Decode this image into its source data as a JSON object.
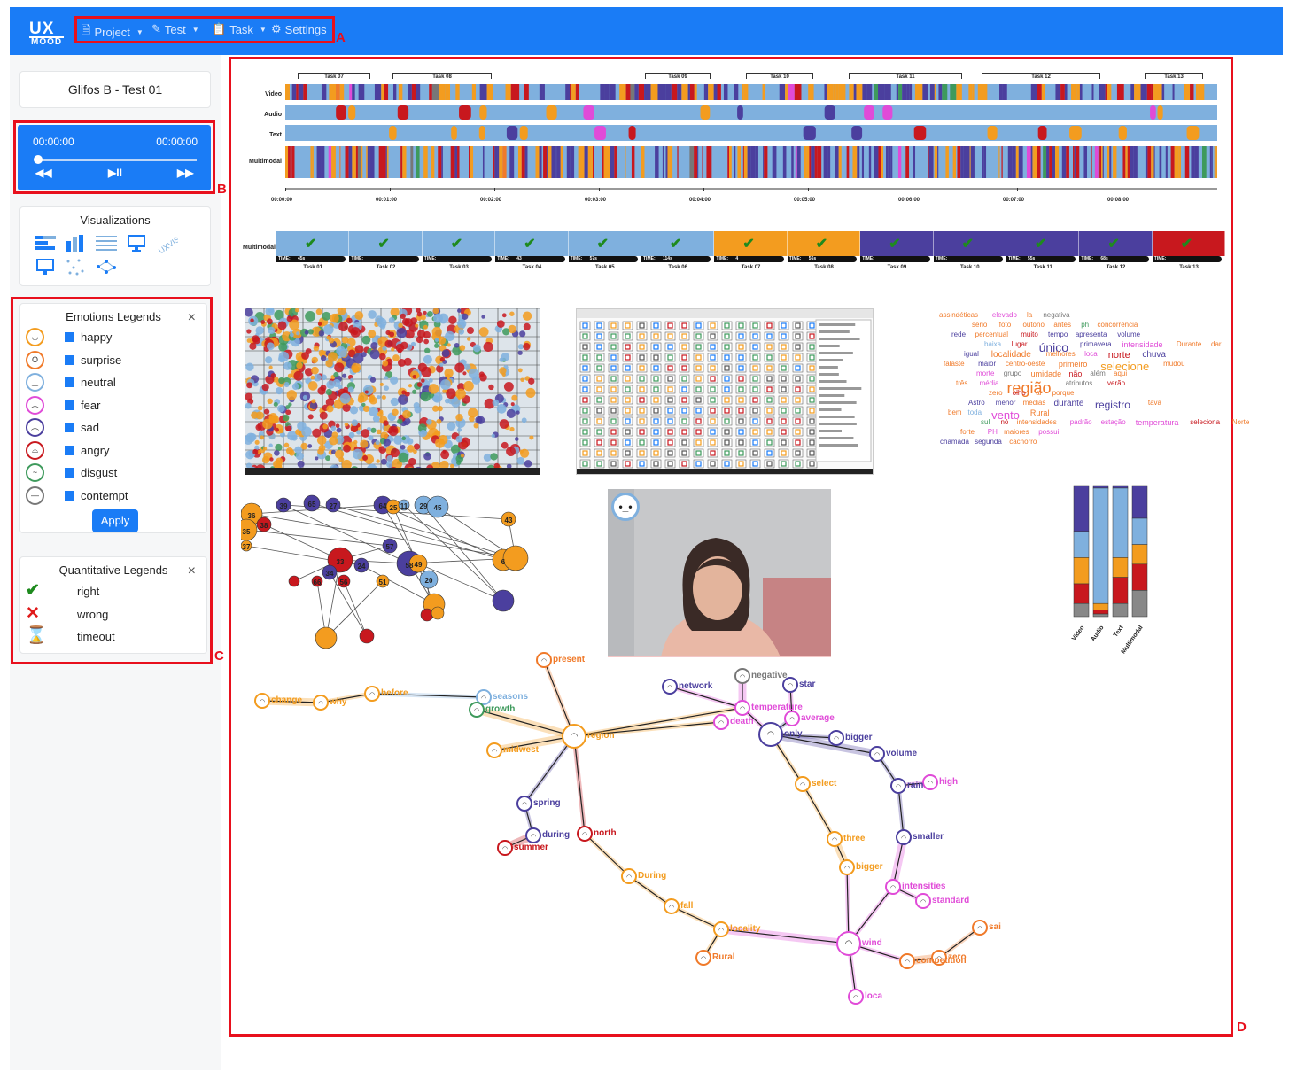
{
  "app": {
    "logo_top": "UX",
    "logo_bottom": "MOOD"
  },
  "nav": [
    {
      "label": "Project",
      "icon": "file-icon"
    },
    {
      "label": "Test",
      "icon": "test-icon"
    },
    {
      "label": "Task",
      "icon": "clipboard-icon"
    },
    {
      "label": "Settings",
      "icon": "gear-icon"
    }
  ],
  "callouts": {
    "a": "A",
    "b": "B",
    "c": "C",
    "d": "D"
  },
  "test_title": "Glifos B - Test 01",
  "player": {
    "current": "00:00:00",
    "total": "00:00:00",
    "rewind": "◀◀",
    "play_pause": "▶II",
    "forward": "▶▶",
    "progress": 0
  },
  "visualizations": {
    "title": "Visualizations",
    "icons": [
      "timeline-icon",
      "bar-chart-icon",
      "table-icon",
      "monitor-icon",
      "word-cloud-icon",
      "screen-icon",
      "scatter-icon",
      "graph-icon"
    ]
  },
  "emotions_legend": {
    "title": "Emotions Legends",
    "close": "×",
    "items": [
      {
        "label": "happy",
        "color": "#f39c1f"
      },
      {
        "label": "surprise",
        "color": "#f07a2a"
      },
      {
        "label": "neutral",
        "color": "#7fb0de"
      },
      {
        "label": "fear",
        "color": "#e04bd8"
      },
      {
        "label": "sad",
        "color": "#4b3f9e"
      },
      {
        "label": "angry",
        "color": "#c8181e"
      },
      {
        "label": "disgust",
        "color": "#3e9a5c"
      },
      {
        "label": "contempt",
        "color": "#777777"
      }
    ],
    "apply": "Apply"
  },
  "quant_legend": {
    "title": "Quantitative Legends",
    "close": "×",
    "items": [
      {
        "label": "right",
        "icon": "checkmark-icon",
        "glyph": "✔",
        "color": "#1e8a1e"
      },
      {
        "label": "wrong",
        "icon": "cross-icon",
        "glyph": "✕",
        "color": "#e01a1a"
      },
      {
        "label": "timeout",
        "icon": "hourglass-icon",
        "glyph": "⌛",
        "color": "#f08a20"
      }
    ]
  },
  "timeline": {
    "tasks": [
      "Task 07",
      "Task 08",
      "Task 09",
      "Task 10",
      "Task 11",
      "Task 12",
      "Task 13"
    ],
    "rows": [
      "Video",
      "Audio",
      "Text",
      "Multimodal"
    ],
    "time_ticks": [
      "00:00:00",
      "00:01:00",
      "00:02:00",
      "00:03:00",
      "00:04:00",
      "00:05:00",
      "00:06:00",
      "00:07:00",
      "00:08:00"
    ]
  },
  "task_bar": {
    "row_label": "Multimodal",
    "check": "✔",
    "time_prefix": "TIME:",
    "tasks": [
      {
        "label": "Task 01",
        "time": "45s",
        "color": "#7fb0de"
      },
      {
        "label": "Task 02",
        "time": "",
        "color": "#7fb0de"
      },
      {
        "label": "Task 03",
        "time": "",
        "color": "#7fb0de"
      },
      {
        "label": "Task 04",
        "time": "43",
        "color": "#7fb0de"
      },
      {
        "label": "Task 05",
        "time": "57s",
        "color": "#7fb0de"
      },
      {
        "label": "Task 06",
        "time": "114s",
        "color": "#7fb0de"
      },
      {
        "label": "Task 07",
        "time": "4",
        "color": "#f39c1f"
      },
      {
        "label": "Task 08",
        "time": "56s",
        "color": "#f39c1f"
      },
      {
        "label": "Task 09",
        "time": "",
        "color": "#4b3f9e"
      },
      {
        "label": "Task 10",
        "time": "",
        "color": "#4b3f9e"
      },
      {
        "label": "Task 11",
        "time": "55s",
        "color": "#4b3f9e"
      },
      {
        "label": "Task 12",
        "time": "68s",
        "color": "#4b3f9e"
      },
      {
        "label": "Task 13",
        "time": "",
        "color": "#c8181e"
      }
    ]
  },
  "word_cloud": [
    {
      "t": "assindéticas",
      "c": "#f07a2a",
      "s": 8
    },
    {
      "t": "elevado",
      "c": "#e04bd8",
      "s": 8
    },
    {
      "t": "la",
      "c": "#f07a2a",
      "s": 8
    },
    {
      "t": "negativa",
      "c": "#777777",
      "s": 8
    },
    {
      "t": "sério",
      "c": "#f07a2a",
      "s": 8
    },
    {
      "t": "foto",
      "c": "#f07a2a",
      "s": 8
    },
    {
      "t": "outono",
      "c": "#f07a2a",
      "s": 8
    },
    {
      "t": "antes",
      "c": "#f07a2a",
      "s": 8
    },
    {
      "t": "ph",
      "c": "#3e9a5c",
      "s": 8
    },
    {
      "t": "concorrência",
      "c": "#f07a2a",
      "s": 8
    },
    {
      "t": "rede",
      "c": "#4b3f9e",
      "s": 8
    },
    {
      "t": "percentual",
      "c": "#f07a2a",
      "s": 8
    },
    {
      "t": "muito",
      "c": "#c8181e",
      "s": 8
    },
    {
      "t": "tempo",
      "c": "#4b3f9e",
      "s": 8
    },
    {
      "t": "apresenta",
      "c": "#4b3f9e",
      "s": 8
    },
    {
      "t": "volume",
      "c": "#4b3f9e",
      "s": 8
    },
    {
      "t": "baixa",
      "c": "#7fb0de",
      "s": 8
    },
    {
      "t": "lugar",
      "c": "#c8181e",
      "s": 8
    },
    {
      "t": "único",
      "c": "#4b3f9e",
      "s": 14
    },
    {
      "t": "primavera",
      "c": "#4b3f9e",
      "s": 8
    },
    {
      "t": "intensidade",
      "c": "#e04bd8",
      "s": 9
    },
    {
      "t": "Durante",
      "c": "#f07a2a",
      "s": 8
    },
    {
      "t": "dar",
      "c": "#f07a2a",
      "s": 8
    },
    {
      "t": "igual",
      "c": "#4b3f9e",
      "s": 8
    },
    {
      "t": "localidade",
      "c": "#f07a2a",
      "s": 10
    },
    {
      "t": "melhores",
      "c": "#f07a2a",
      "s": 8
    },
    {
      "t": "loca",
      "c": "#e04bd8",
      "s": 8
    },
    {
      "t": "norte",
      "c": "#c8181e",
      "s": 11
    },
    {
      "t": "chuva",
      "c": "#4b3f9e",
      "s": 10
    },
    {
      "t": "falaste",
      "c": "#f07a2a",
      "s": 8
    },
    {
      "t": "maior",
      "c": "#4b3f9e",
      "s": 8
    },
    {
      "t": "centro-oeste",
      "c": "#f07a2a",
      "s": 8
    },
    {
      "t": "primeiro",
      "c": "#f07a2a",
      "s": 9
    },
    {
      "t": "selecione",
      "c": "#f39c1f",
      "s": 13
    },
    {
      "t": "mudou",
      "c": "#f07a2a",
      "s": 8
    },
    {
      "t": "morte",
      "c": "#e04bd8",
      "s": 8
    },
    {
      "t": "grupo",
      "c": "#777777",
      "s": 8
    },
    {
      "t": "umidade",
      "c": "#f07a2a",
      "s": 9
    },
    {
      "t": "não",
      "c": "#c8181e",
      "s": 9
    },
    {
      "t": "além",
      "c": "#777777",
      "s": 8
    },
    {
      "t": "aqui",
      "c": "#f07a2a",
      "s": 8
    },
    {
      "t": "três",
      "c": "#f07a2a",
      "s": 8
    },
    {
      "t": "média",
      "c": "#e04bd8",
      "s": 8
    },
    {
      "t": "região",
      "c": "#f07a2a",
      "s": 18
    },
    {
      "t": "atributos",
      "c": "#777777",
      "s": 8
    },
    {
      "t": "verão",
      "c": "#c8181e",
      "s": 8
    },
    {
      "t": "zero",
      "c": "#f07a2a",
      "s": 8
    },
    {
      "t": "olho",
      "c": "#c8181e",
      "s": 8
    },
    {
      "t": "ar",
      "c": "#f07a2a",
      "s": 8
    },
    {
      "t": "porque",
      "c": "#f07a2a",
      "s": 8
    },
    {
      "t": "Astro",
      "c": "#4b3f9e",
      "s": 8
    },
    {
      "t": "menor",
      "c": "#4b3f9e",
      "s": 8
    },
    {
      "t": "médias",
      "c": "#f07a2a",
      "s": 8
    },
    {
      "t": "durante",
      "c": "#4b3f9e",
      "s": 10
    },
    {
      "t": "registro",
      "c": "#4b3f9e",
      "s": 12
    },
    {
      "t": "tava",
      "c": "#f07a2a",
      "s": 8
    },
    {
      "t": "bem",
      "c": "#f07a2a",
      "s": 8
    },
    {
      "t": "toda",
      "c": "#7fb0de",
      "s": 8
    },
    {
      "t": "vento",
      "c": "#e04bd8",
      "s": 13
    },
    {
      "t": "Rural",
      "c": "#f07a2a",
      "s": 9
    },
    {
      "t": "sul",
      "c": "#3e9a5c",
      "s": 8
    },
    {
      "t": "nó",
      "c": "#c8181e",
      "s": 8
    },
    {
      "t": "intensidades",
      "c": "#f07a2a",
      "s": 8
    },
    {
      "t": "padrão",
      "c": "#e04bd8",
      "s": 8
    },
    {
      "t": "estação",
      "c": "#e04bd8",
      "s": 8
    },
    {
      "t": "temperatura",
      "c": "#e04bd8",
      "s": 9
    },
    {
      "t": "seleciona",
      "c": "#c8181e",
      "s": 8
    },
    {
      "t": "Norte",
      "c": "#f07a2a",
      "s": 8
    },
    {
      "t": "forte",
      "c": "#f07a2a",
      "s": 8
    },
    {
      "t": "PH",
      "c": "#e04bd8",
      "s": 8
    },
    {
      "t": "maiores",
      "c": "#f07a2a",
      "s": 8
    },
    {
      "t": "possui",
      "c": "#e04bd8",
      "s": 8
    },
    {
      "t": "chamada",
      "c": "#4b3f9e",
      "s": 8
    },
    {
      "t": "segunda",
      "c": "#4b3f9e",
      "s": 8
    },
    {
      "t": "cachorro",
      "c": "#f07a2a",
      "s": 8
    },
    {
      "t": "Ainda",
      "c": "#f07a2a",
      "s": 8
    }
  ],
  "network_labels": [
    "36",
    "35",
    "38",
    "37",
    "39",
    "65",
    "27",
    "64",
    "25",
    "11",
    "29",
    "45",
    "43",
    "57",
    "33",
    "34",
    "24",
    "66",
    "56",
    "58",
    "49",
    "20",
    "51",
    "6"
  ],
  "stacked": {
    "categories": [
      "Video",
      "Audio",
      "Text",
      "Multimodal"
    ],
    "values": [
      [
        0.35,
        0.55,
        0.75,
        0.9
      ],
      [
        0.02,
        0.9,
        0.95,
        0.98
      ],
      [
        0.02,
        0.55,
        0.7,
        0.9
      ],
      [
        0.25,
        0.45,
        0.6,
        0.8
      ]
    ],
    "colors": [
      "#4b3f9e",
      "#7fb0de",
      "#f39c1f",
      "#c8181e",
      "#888888"
    ]
  },
  "graph_words": [
    {
      "t": "present",
      "c": "#f07a2a"
    },
    {
      "t": "network",
      "c": "#4b3f9e"
    },
    {
      "t": "negative",
      "c": "#777777"
    },
    {
      "t": "star",
      "c": "#4b3f9e"
    },
    {
      "t": "change",
      "c": "#f39c1f"
    },
    {
      "t": "why",
      "c": "#f39c1f"
    },
    {
      "t": "before",
      "c": "#f39c1f"
    },
    {
      "t": "seasons",
      "c": "#7fb0de"
    },
    {
      "t": "growth",
      "c": "#3e9a5c"
    },
    {
      "t": "temperature",
      "c": "#e04bd8"
    },
    {
      "t": "death",
      "c": "#e04bd8"
    },
    {
      "t": "average",
      "c": "#e04bd8"
    },
    {
      "t": "region",
      "c": "#f39c1f"
    },
    {
      "t": "only",
      "c": "#4b3f9e"
    },
    {
      "t": "bigger",
      "c": "#4b3f9e"
    },
    {
      "t": "midwest",
      "c": "#f39c1f"
    },
    {
      "t": "volume",
      "c": "#4b3f9e"
    },
    {
      "t": "high",
      "c": "#e04bd8"
    },
    {
      "t": "select",
      "c": "#f39c1f"
    },
    {
      "t": "rain",
      "c": "#4b3f9e"
    },
    {
      "t": "spring",
      "c": "#4b3f9e"
    },
    {
      "t": "during",
      "c": "#4b3f9e"
    },
    {
      "t": "north",
      "c": "#c8181e"
    },
    {
      "t": "summer",
      "c": "#c8181e"
    },
    {
      "t": "three",
      "c": "#f39c1f"
    },
    {
      "t": "smaller",
      "c": "#4b3f9e"
    },
    {
      "t": "During",
      "c": "#f39c1f"
    },
    {
      "t": "bigger",
      "c": "#f39c1f"
    },
    {
      "t": "intensities",
      "c": "#e04bd8"
    },
    {
      "t": "standard",
      "c": "#e04bd8"
    },
    {
      "t": "fall",
      "c": "#f39c1f"
    },
    {
      "t": "locality",
      "c": "#f39c1f"
    },
    {
      "t": "wind",
      "c": "#e04bd8"
    },
    {
      "t": "Rural",
      "c": "#f07a2a"
    },
    {
      "t": "competition",
      "c": "#f07a2a"
    },
    {
      "t": "zero",
      "c": "#f07a2a"
    },
    {
      "t": "sai",
      "c": "#f07a2a"
    },
    {
      "t": "loca",
      "c": "#e04bd8"
    }
  ]
}
